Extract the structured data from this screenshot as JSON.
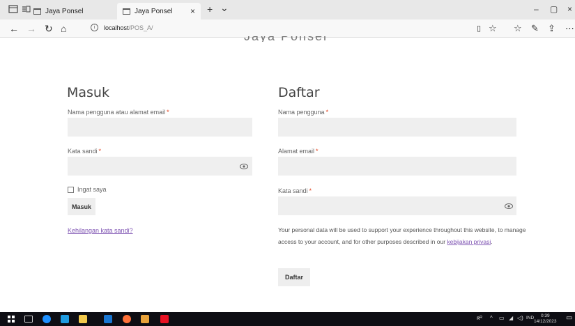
{
  "browser": {
    "tabs": [
      {
        "title": "Jaya Ponsel"
      },
      {
        "title": "Jaya Ponsel"
      }
    ],
    "new_tab_glyph": "+",
    "tab_list_glyph": "⌄",
    "tab_close_glyph": "×",
    "window_controls": {
      "minimize": "–",
      "maximize": "▢",
      "close": "×"
    },
    "url": {
      "host": "localhost",
      "path": "/POS_A/"
    },
    "icons": [
      "back-icon",
      "forward-icon",
      "refresh-icon",
      "home-icon",
      "info-icon",
      "reading-view-icon",
      "favorite-star-icon",
      "favorites-list-icon",
      "pen-icon",
      "share-icon",
      "more-icon"
    ]
  },
  "page": {
    "login": {
      "title": "Masuk",
      "username_label": "Nama pengguna atau alamat email",
      "password_label": "Kata sandi",
      "required_mark": "*",
      "remember_label": "Ingat saya",
      "submit_label": "Masuk",
      "lost_password_link": "Kehilangan kata sandi?"
    },
    "register": {
      "title": "Daftar",
      "username_label": "Nama pengguna",
      "email_label": "Alamat email",
      "password_label": "Kata sandi",
      "required_mark": "*",
      "privacy_text": "Your personal data will be used to support your experience throughout this website, to manage access to your account, and for other purposes described in our",
      "privacy_link": "kebijakan privasi",
      "privacy_end": ".",
      "submit_label": "Daftar"
    }
  },
  "taskbar": {
    "apps": [
      "windows-start-icon",
      "task-view-icon",
      "edge-icon",
      "store-icon",
      "file-explorer-icon",
      "mail-icon",
      "firefox-icon",
      "photos-icon",
      "app-icon"
    ],
    "tray": {
      "people_glyph": "ᴿᴿ",
      "chevron": "^",
      "language": "IND",
      "time": "0:39",
      "date": "14/12/2023"
    },
    "colors": {
      "edge": "#1e90ff",
      "store": "#1f9be0",
      "explorer": "#f2c94c",
      "mail": "#1976d2",
      "firefox": "#ff7139",
      "photos": "#e8a23a",
      "app": "#e81123"
    }
  }
}
